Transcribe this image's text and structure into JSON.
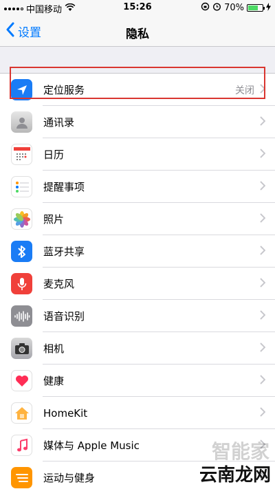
{
  "status": {
    "carrier": "中国移动",
    "time": "15:26",
    "battery": "70%",
    "battery_level": 0.7
  },
  "nav": {
    "back_label": "设置",
    "title": "隐私"
  },
  "rows": [
    {
      "label": "定位服务",
      "value": "关闭",
      "icon": "location-arrow-icon"
    },
    {
      "label": "通讯录",
      "icon": "contacts-icon"
    },
    {
      "label": "日历",
      "icon": "calendar-icon"
    },
    {
      "label": "提醒事项",
      "icon": "reminders-icon"
    },
    {
      "label": "照片",
      "icon": "photos-icon"
    },
    {
      "label": "蓝牙共享",
      "icon": "bluetooth-icon"
    },
    {
      "label": "麦克风",
      "icon": "microphone-icon"
    },
    {
      "label": "语音识别",
      "icon": "speech-recognition-icon"
    },
    {
      "label": "相机",
      "icon": "camera-icon"
    },
    {
      "label": "健康",
      "icon": "health-icon"
    },
    {
      "label": "HomeKit",
      "icon": "homekit-icon"
    },
    {
      "label": "媒体与 Apple Music",
      "icon": "music-icon"
    },
    {
      "label": "运动与健身",
      "icon": "motion-fitness-icon"
    }
  ],
  "watermark": {
    "main": "云南龙网",
    "faint": "智能家"
  },
  "colors": {
    "accent": "#007aff",
    "highlight": "#d9352f"
  }
}
